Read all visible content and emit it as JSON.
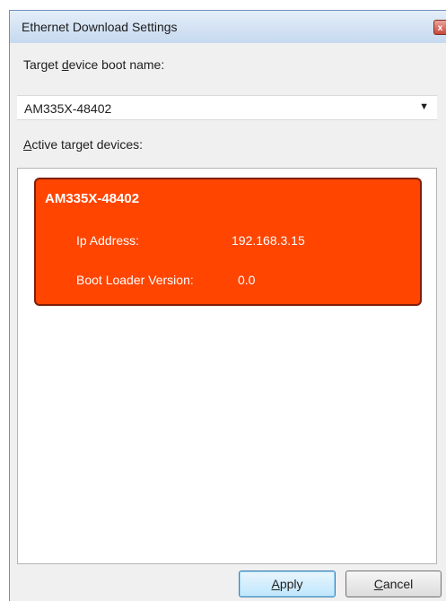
{
  "window": {
    "title": "Ethernet Download Settings",
    "close_glyph": "x"
  },
  "boot_name": {
    "label_pre": "Target ",
    "label_accel": "d",
    "label_post": "evice boot name:",
    "selected_value": "AM335X-48402",
    "dropdown_icon": "chevron-down-icon"
  },
  "active_devices": {
    "label_accel": "A",
    "label_post": "ctive target devices:",
    "items": [
      {
        "name": "AM335X-48402",
        "ip_label": "Ip Address:",
        "ip_value": "192.168.3.15",
        "boot_loader_label": "Boot Loader Version:",
        "boot_loader_value": "0.0",
        "color": "#ff4500"
      }
    ]
  },
  "buttons": {
    "apply_accel": "A",
    "apply_rest": "pply",
    "cancel_accel": "C",
    "cancel_rest": "ancel"
  }
}
